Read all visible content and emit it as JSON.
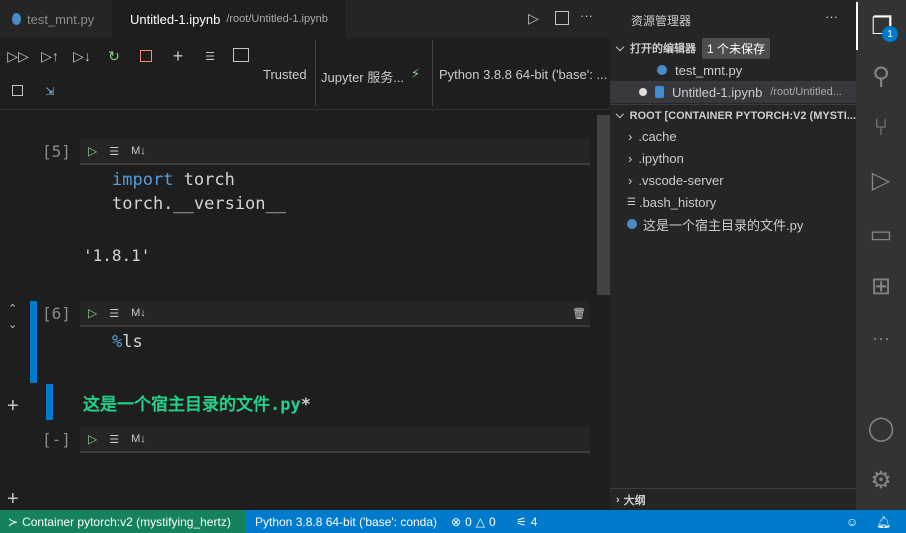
{
  "tabs": [
    {
      "label": "test_mnt.py",
      "active": false
    },
    {
      "label": "Untitled-1.ipynb",
      "path": "/root/Untitled-1.ipynb",
      "active": true,
      "dirty": true
    }
  ],
  "toolbar": {
    "trusted": "Trusted",
    "jupyter_server": "Jupyter 服务...",
    "kernel": "Python 3.8.8 64-bit ('base': ..."
  },
  "cells": [
    {
      "count": "[5]",
      "code": [
        "import",
        "torch",
        "torch.__version__"
      ],
      "output": "'1.8.1'",
      "md": "M↓"
    },
    {
      "count": "[6]",
      "code": [
        "%",
        "ls"
      ],
      "output": "这是一个宿主目录的文件.py",
      "output_suffix": "*",
      "md": "M↓"
    },
    {
      "count": "[-]",
      "md": "M↓"
    }
  ],
  "sidebar": {
    "title": "资源管理器",
    "open_editors": {
      "label": "打开的编辑器",
      "badge": "1 个未保存",
      "items": [
        {
          "name": "test_mnt.py"
        },
        {
          "name": "Untitled-1.ipynb",
          "path": "/root/Untitled..."
        }
      ]
    },
    "root": {
      "label": "ROOT [CONTAINER PYTORCH:V2 (MYSTI...",
      "items": [
        {
          "name": ".cache",
          "type": "folder"
        },
        {
          "name": ".ipython",
          "type": "folder"
        },
        {
          "name": ".vscode-server",
          "type": "folder"
        },
        {
          "name": ".bash_history",
          "type": "file"
        },
        {
          "name": "这是一个宿主目录的文件.py",
          "type": "python"
        }
      ]
    },
    "outline": "大纲"
  },
  "activity": {
    "explorer_badge": "1"
  },
  "status": {
    "remote": "Container pytorch:v2 (mystifying_hertz)",
    "interpreter": "Python 3.8.8 64-bit ('base': conda)",
    "errors": "0",
    "warnings": "0",
    "ports": "4"
  },
  "colors": {
    "accent": "#007acc",
    "remote": "#16825d",
    "keyword": "#569cd6",
    "output_green": "#23d18b"
  }
}
